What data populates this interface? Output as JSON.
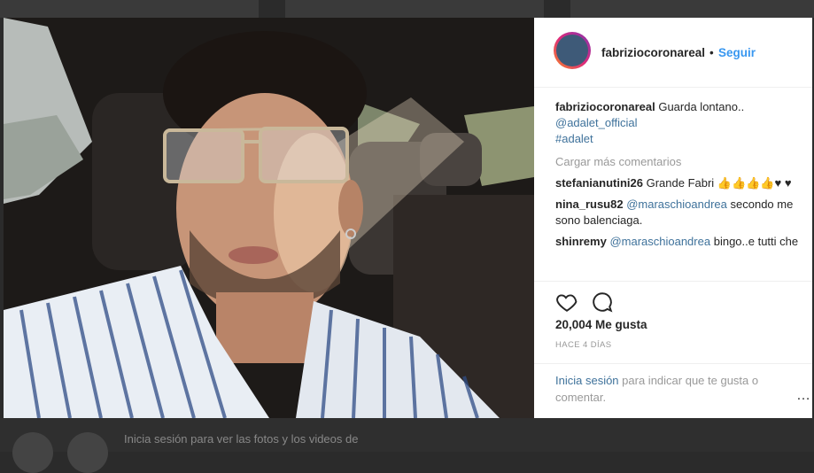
{
  "post": {
    "username": "fabriziocoronareal",
    "separator": "•",
    "follow_label": "Seguir",
    "caption_text": "Guarda lontano..",
    "caption_mention": "@adalet_official",
    "caption_hashtag": "#adalet",
    "load_more_label": "Cargar más comentarios",
    "comments": [
      {
        "user": "stefanianutini26",
        "mention": "",
        "text": "Grande Fabri 👍👍👍👍♥ ♥"
      },
      {
        "user": "nina_rusu82",
        "mention": "@maraschioandrea",
        "text": "secondo me sono balenciaga."
      },
      {
        "user": "shinremy",
        "mention": "@maraschioandrea",
        "text": "bingo..e tutti che ci cascano come i polli"
      }
    ],
    "likes_label": "20,004 Me gusta",
    "time_label": "HACE 4 DÍAS",
    "login_link": "Inicia sesión",
    "login_text": "para indicar que te gusta o comentar.",
    "more_icon": "…"
  },
  "background": {
    "login_text_line1": "Inicia sesión para ver las fotos y los videos de",
    "login_text_line2": ""
  },
  "icons": {
    "like": "heart-icon",
    "comment": "comment-icon",
    "more": "more-options-icon"
  }
}
